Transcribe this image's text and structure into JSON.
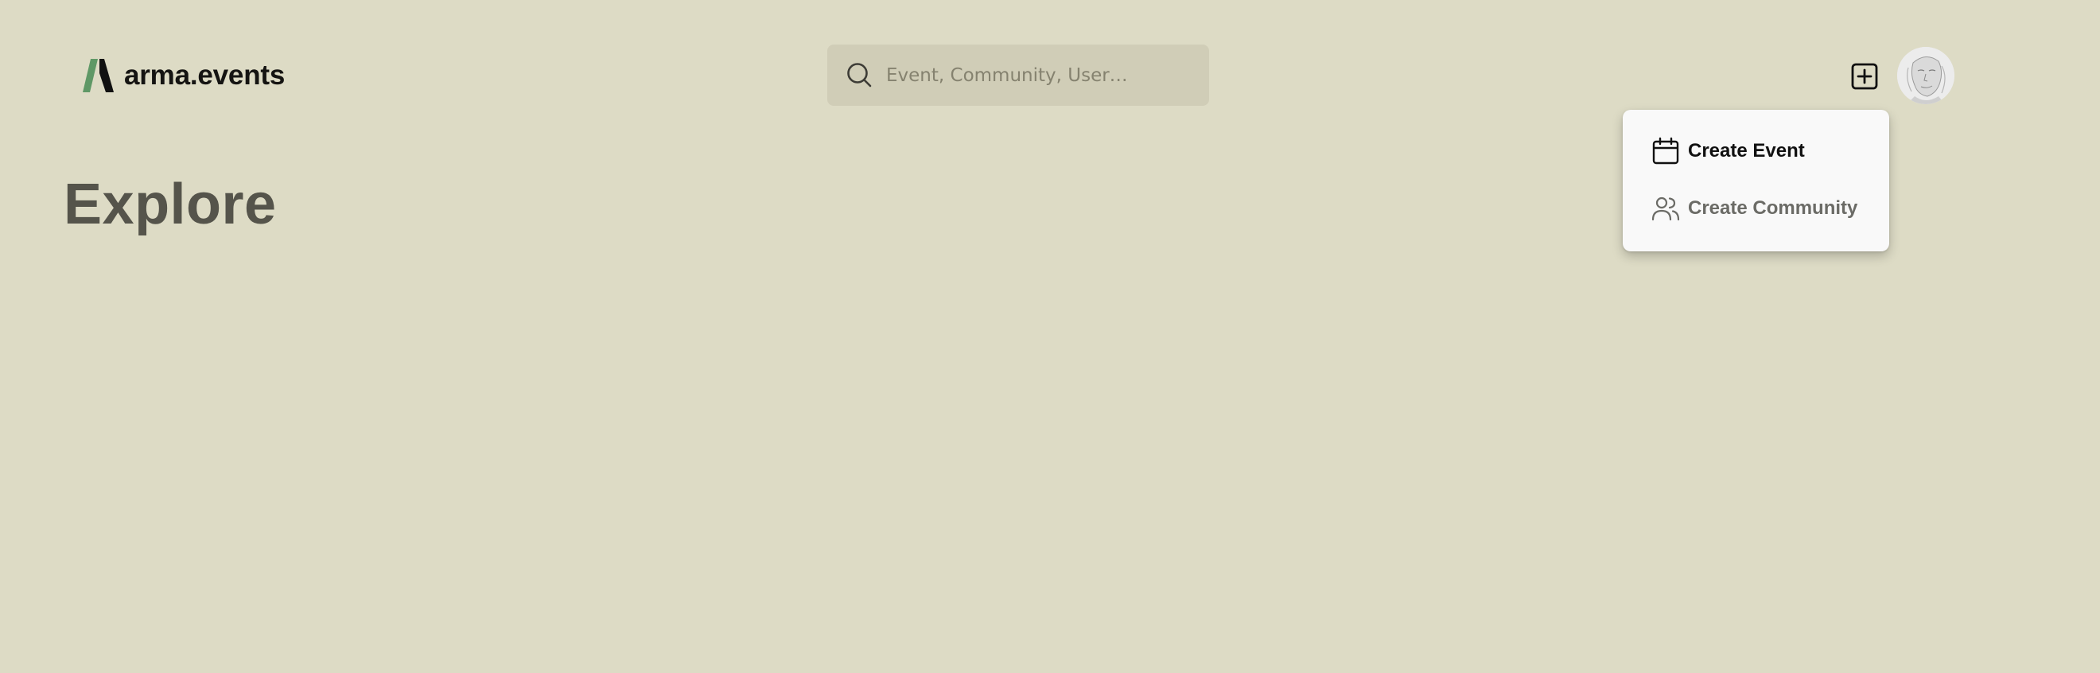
{
  "header": {
    "logo_text": "arma.events",
    "logo_mark_colors": {
      "green": "#5f9866",
      "black": "#111111"
    },
    "search": {
      "placeholder": "Event, Community, User…",
      "value": ""
    },
    "add_icon": "plus-square-icon",
    "avatar_icon": "user-avatar"
  },
  "main": {
    "page_title": "Explore"
  },
  "create_menu": {
    "items": [
      {
        "label": "Create Event",
        "icon": "calendar-icon"
      },
      {
        "label": "Create Community",
        "icon": "users-icon"
      }
    ]
  },
  "colors": {
    "background": "#dddbc5",
    "search_background": "#d0cdb7",
    "menu_background": "#f9f9f9",
    "title_text": "#55544b"
  }
}
